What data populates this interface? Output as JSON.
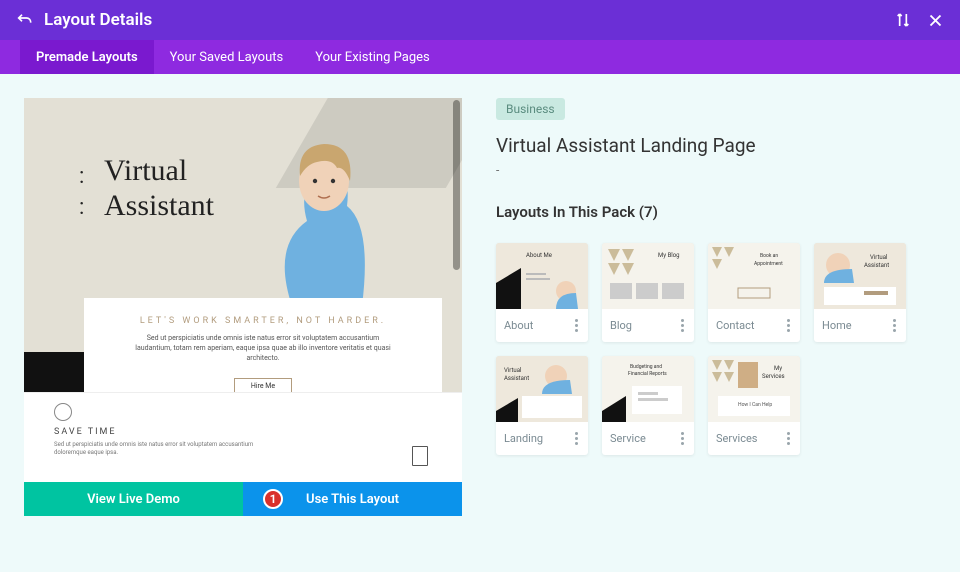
{
  "header": {
    "title": "Layout Details"
  },
  "tabs": [
    {
      "label": "Premade Layouts",
      "active": true
    },
    {
      "label": "Your Saved Layouts",
      "active": false
    },
    {
      "label": "Your Existing Pages",
      "active": false
    }
  ],
  "preview": {
    "title_line1": "Virtual",
    "title_line2": "Assistant",
    "tagline": "LET'S WORK SMARTER, NOT HARDER.",
    "lorem": "Sed ut perspiciatis unde omnis iste natus error sit voluptatem accusantium laudantium, totam rem aperiam, eaque ipsa quae ab illo inventore veritatis et quasi architecto.",
    "cta": "Hire Me",
    "save_title": "SAVE TIME",
    "save_body": "Sed ut perspiciatis unde omnis iste natus error sit voluptatem accusantium doloremque eaque ipsa."
  },
  "actions": {
    "demo": "View Live Demo",
    "use": "Use This Layout",
    "badge": "1"
  },
  "meta": {
    "category": "Business",
    "title": "Virtual Assistant Landing Page",
    "dash": "-",
    "pack_label": "Layouts In This Pack (7)"
  },
  "pack": [
    {
      "name": "About"
    },
    {
      "name": "Blog"
    },
    {
      "name": "Contact"
    },
    {
      "name": "Home"
    },
    {
      "name": "Landing"
    },
    {
      "name": "Service"
    },
    {
      "name": "Services"
    }
  ]
}
